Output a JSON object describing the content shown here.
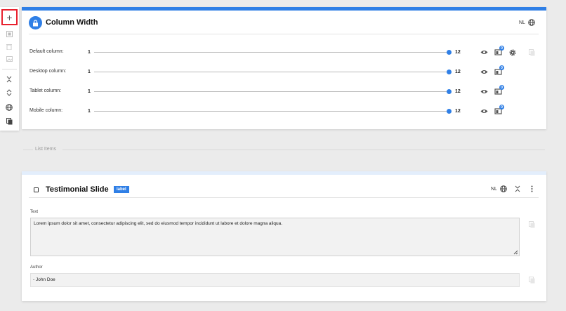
{
  "toolbar": {
    "icons": [
      "plus-icon",
      "square-icon",
      "trash-icon",
      "image-icon",
      "collapse-icon",
      "expand-icon",
      "globe-icon",
      "copy-icon"
    ],
    "add_label": "+"
  },
  "column_width": {
    "title": "Column Width",
    "lang": "NL",
    "rows": [
      {
        "label": "Default column:",
        "min": "1",
        "max": "12",
        "badge": "0"
      },
      {
        "label": "Desktop column:",
        "min": "1",
        "max": "12",
        "badge": "0"
      },
      {
        "label": "Tablet column:",
        "min": "1",
        "max": "12",
        "badge": "0"
      },
      {
        "label": "Mobile column:",
        "min": "1",
        "max": "12",
        "badge": "0"
      }
    ]
  },
  "list_items": {
    "label": "List Items"
  },
  "testimonial": {
    "title": "Testimonial Slide",
    "badge": "label",
    "lang": "NL",
    "text_label": "Text",
    "text_value": "Lorem ipsum dolor sit amet, consectetur adipiscing elit, sed do eiusmod tempor incididunt ut labore et dolore magna aliqua.",
    "author_label": "Author",
    "author_value": "- John Doe"
  },
  "colors": {
    "accent": "#2f7fe6",
    "highlight": "#e8212e",
    "background": "#ebebeb"
  }
}
